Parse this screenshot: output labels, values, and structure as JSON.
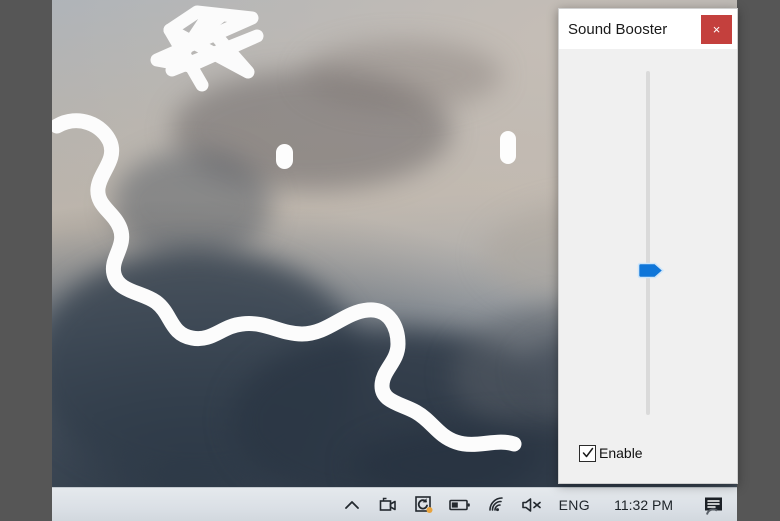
{
  "desktop": {
    "name": "windows-desktop-wallpaper",
    "description": "Sky and clouds photo wallpaper with white drawn annotations",
    "annotations": [
      {
        "name": "star-scribble",
        "type": "doodle"
      },
      {
        "name": "wavy-squiggle-line",
        "type": "doodle"
      },
      {
        "name": "blob-left",
        "type": "doodle"
      },
      {
        "name": "blob-right",
        "type": "doodle"
      }
    ]
  },
  "window": {
    "title": "Sound Booster",
    "close_label": "×",
    "accent_color": "#0f76d9",
    "close_color": "#c4403d",
    "slider": {
      "name": "volume-boost-slider",
      "orientation": "vertical",
      "value_percent": 58,
      "min": 0,
      "max": 100
    },
    "checkbox": {
      "label": "Enable",
      "checked": true,
      "check_glyph": "✓"
    }
  },
  "taskbar": {
    "clock": "11:32 PM",
    "language": "ENG",
    "tray_icons": [
      {
        "name": "show-hidden-icons",
        "glyph": "chevron-up"
      },
      {
        "name": "camera-icon",
        "glyph": "camera"
      },
      {
        "name": "sync-icon",
        "glyph": "refresh"
      },
      {
        "name": "battery-icon",
        "glyph": "battery"
      },
      {
        "name": "wifi-icon",
        "glyph": "wifi"
      },
      {
        "name": "volume-muted-icon",
        "glyph": "speaker-mute"
      }
    ],
    "action_center": "action-center-icon"
  }
}
